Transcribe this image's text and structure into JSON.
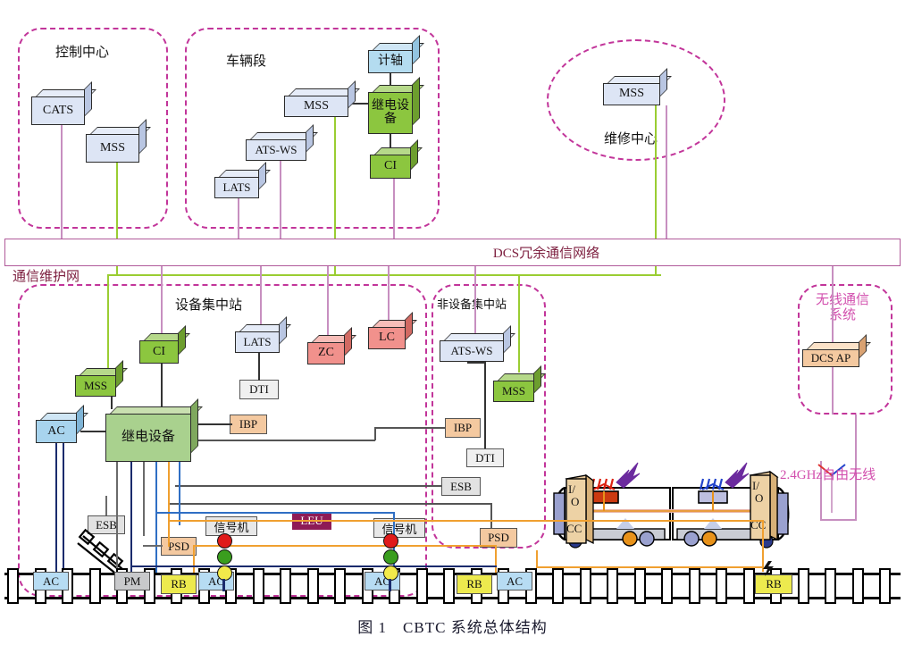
{
  "figure": {
    "caption": "图 1　CBTC 系统总体结构",
    "network_bar_label": "DCS冗余通信网络",
    "maintenance_net_label": "通信维护网",
    "wireless_label": "2.4GHz自由无线"
  },
  "colors": {
    "region_border": "#c2359a",
    "network_line": "#b05a9a",
    "maintenance_line": "#9acd32",
    "blue_box": "#ccd9f0",
    "green_box": "#8cc63f",
    "lightgreen_box": "#a9d18e",
    "salmon_box": "#f1918c",
    "peach_box": "#f4c9a0",
    "skyblue_box": "#a8d4ee",
    "gray_box": "#e2e2e2",
    "yellow_box": "#edea4e",
    "leu_box": "#8e1b56",
    "dcs_bar_text": "#7e2040",
    "wireless_text": "#d24fae"
  },
  "regions": [
    {
      "id": "control-center",
      "label": "控制中心"
    },
    {
      "id": "vehicle-depot",
      "label": "车辆段"
    },
    {
      "id": "maintenance-center",
      "label": "维修中心"
    },
    {
      "id": "equipment-station",
      "label": "设备集中站"
    },
    {
      "id": "non-equipment-station",
      "label": "非设备集中站"
    },
    {
      "id": "wireless-system",
      "label": "无线通信\n系统"
    }
  ],
  "control_center": {
    "label": "控制中心",
    "nodes": [
      {
        "name": "CATS",
        "label": "CATS",
        "color": "blue"
      },
      {
        "name": "MSS",
        "label": "MSS",
        "color": "blue"
      }
    ]
  },
  "vehicle_depot": {
    "label": "车辆段",
    "nodes": [
      {
        "name": "LATS",
        "label": "LATS",
        "color": "blue"
      },
      {
        "name": "ATS-WS",
        "label": "ATS-WS",
        "color": "blue"
      },
      {
        "name": "MSS",
        "label": "MSS",
        "color": "blue"
      },
      {
        "name": "axle-counter",
        "label": "计轴",
        "color": "skyblue"
      },
      {
        "name": "relay-equipment",
        "label": "继电设备",
        "color": "green"
      },
      {
        "name": "CI",
        "label": "CI",
        "color": "green"
      }
    ]
  },
  "maintenance_center": {
    "label": "维修中心",
    "nodes": [
      {
        "name": "MSS",
        "label": "MSS",
        "color": "blue"
      }
    ]
  },
  "equipment_station": {
    "label": "设备集中站",
    "nodes": [
      {
        "name": "MSS",
        "label": "MSS",
        "color": "green"
      },
      {
        "name": "CI",
        "label": "CI",
        "color": "green"
      },
      {
        "name": "LATS",
        "label": "LATS",
        "color": "blue"
      },
      {
        "name": "ZC",
        "label": "ZC",
        "color": "salmon"
      },
      {
        "name": "LC",
        "label": "LC",
        "color": "salmon"
      },
      {
        "name": "DTI",
        "label": "DTI",
        "color": "gray"
      },
      {
        "name": "AC",
        "label": "AC",
        "color": "skyblue"
      },
      {
        "name": "relay-equipment",
        "label": "继电设备",
        "color": "lightgreen"
      },
      {
        "name": "IBP",
        "label": "IBP",
        "color": "peach"
      },
      {
        "name": "ESB",
        "label": "ESB",
        "color": "gray"
      },
      {
        "name": "PSD",
        "label": "PSD",
        "color": "peach"
      },
      {
        "name": "LEU",
        "label": "LEU",
        "color": "leu"
      },
      {
        "name": "signal-1",
        "label": "信号机",
        "color": "gray"
      },
      {
        "name": "signal-2",
        "label": "信号机",
        "color": "gray"
      }
    ]
  },
  "non_equipment_station": {
    "label": "非设备集中站",
    "nodes": [
      {
        "name": "ATS-WS",
        "label": "ATS-WS",
        "color": "blue"
      },
      {
        "name": "MSS",
        "label": "MSS",
        "color": "green"
      },
      {
        "name": "IBP",
        "label": "IBP",
        "color": "peach"
      },
      {
        "name": "DTI",
        "label": "DTI",
        "color": "gray"
      },
      {
        "name": "ESB",
        "label": "ESB",
        "color": "gray"
      },
      {
        "name": "PSD",
        "label": "PSD",
        "color": "peach"
      }
    ]
  },
  "wireless_system": {
    "label_line1": "无线通信",
    "label_line2": "系统",
    "nodes": [
      {
        "name": "DCS-AP",
        "label": "DCS AP",
        "color": "peach"
      }
    ]
  },
  "trackside": {
    "ac_boxes": [
      "AC",
      "AC",
      "AC",
      "AC"
    ],
    "rb_boxes": [
      "RB",
      "RB",
      "RB"
    ],
    "point_machine": "PM",
    "signal_label": "信号机"
  },
  "train": {
    "car1_cabinet": {
      "io": "I/",
      "io2": "O",
      "cc": "CC"
    },
    "car2_cabinet": {
      "io": "I/",
      "io2": "O",
      "cc": "CC"
    },
    "wireless_label": "2.4GHz自由无线"
  }
}
